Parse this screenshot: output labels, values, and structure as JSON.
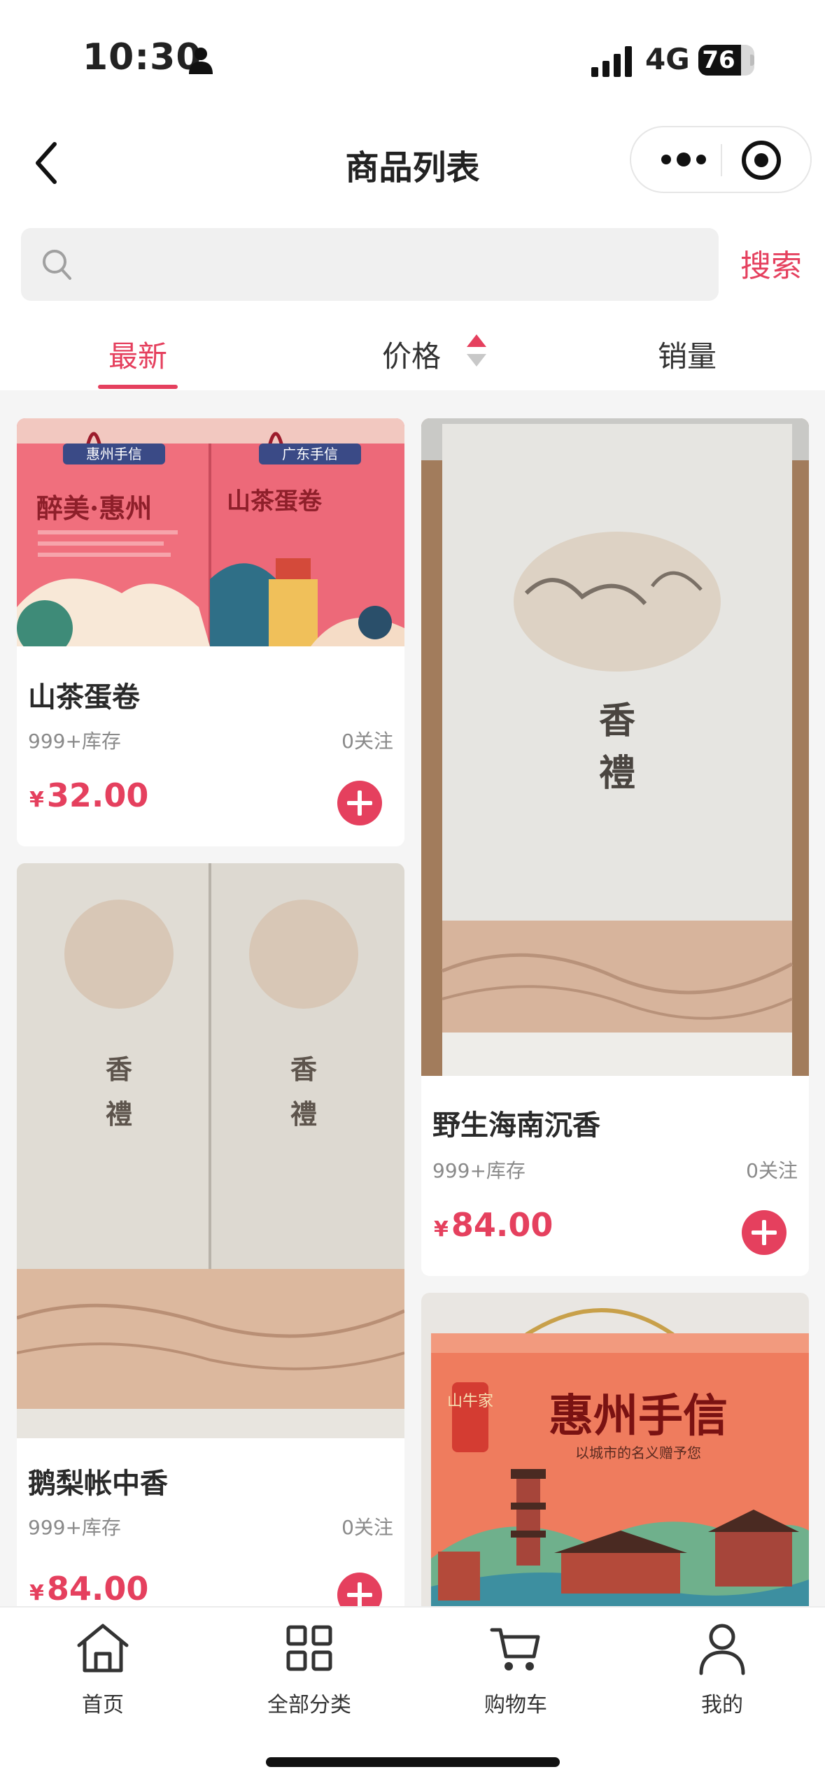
{
  "status": {
    "time": "10:30",
    "network": "4G",
    "battery": "76",
    "battery_level": 0.76
  },
  "nav": {
    "title": "商品列表"
  },
  "search": {
    "placeholder": "",
    "button": "搜索"
  },
  "tabs": [
    {
      "label": "最新",
      "active": true
    },
    {
      "label": "价格",
      "active": false
    },
    {
      "label": "销量",
      "active": false
    }
  ],
  "products": [
    {
      "name": "山茶蛋卷",
      "stock": "999+库存",
      "follow": "0关注",
      "currency": "¥",
      "price": "32.00"
    },
    {
      "name": "野生海南沉香",
      "stock": "999+库存",
      "follow": "0关注",
      "currency": "¥",
      "price": "84.00"
    },
    {
      "name": "鹅梨帐中香",
      "stock": "999+库存",
      "follow": "0关注",
      "currency": "¥",
      "price": "84.00"
    },
    {
      "name": "",
      "stock": "",
      "follow": "",
      "currency": "",
      "price": ""
    }
  ],
  "images": {
    "egg_roll_box": {
      "labels": [
        "惠州手信",
        "广东手信",
        "醉美·惠州",
        "山茶蛋卷"
      ]
    },
    "incense_box": {
      "labels": [
        "香",
        "禮"
      ]
    },
    "gift_box": {
      "labels": [
        "惠州手信",
        "山牛家",
        "以城市的名义赠予您"
      ]
    }
  },
  "tabbar": [
    {
      "label": "首页",
      "icon": "home-icon"
    },
    {
      "label": "全部分类",
      "icon": "grid-icon"
    },
    {
      "label": "购物车",
      "icon": "cart-icon"
    },
    {
      "label": "我的",
      "icon": "person-icon"
    }
  ]
}
